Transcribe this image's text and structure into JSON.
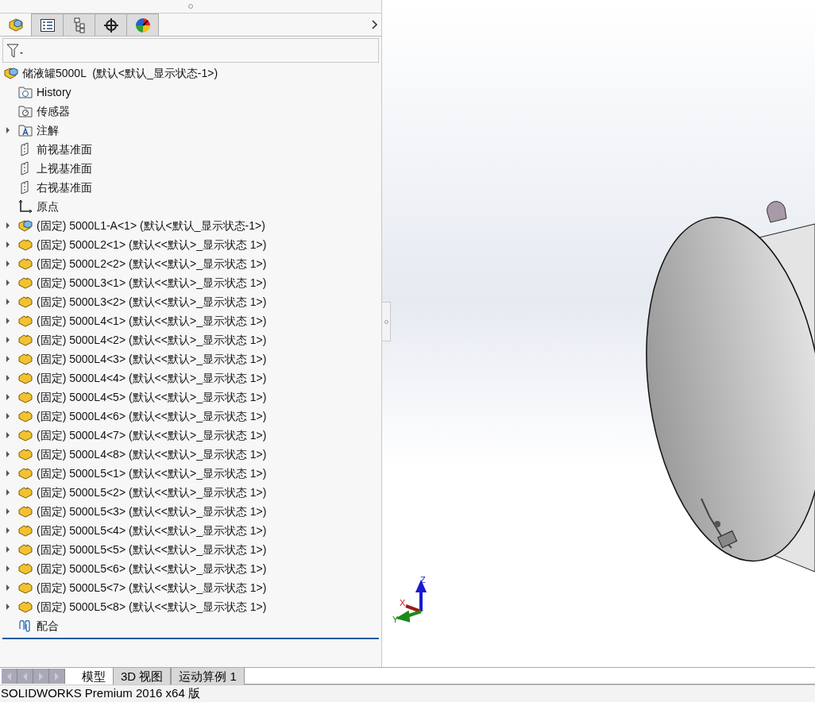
{
  "panel_tabs": [
    {
      "kind": "feature-tree",
      "selected": true
    },
    {
      "kind": "property",
      "selected": false
    },
    {
      "kind": "config",
      "selected": false
    },
    {
      "kind": "dimxpert",
      "selected": false
    },
    {
      "kind": "display",
      "selected": false
    }
  ],
  "tree": {
    "label": "储液罐5000L  (默认<默认_显示状态-1>)",
    "kind": "assembly",
    "children": [
      {
        "label": "History",
        "kind": "history"
      },
      {
        "label": "传感器",
        "kind": "sensor"
      },
      {
        "label": "注解",
        "kind": "annotation",
        "expanded": false
      },
      {
        "label": "前视基准面",
        "kind": "plane"
      },
      {
        "label": "上视基准面",
        "kind": "plane"
      },
      {
        "label": "右视基准面",
        "kind": "plane"
      },
      {
        "label": "原点",
        "kind": "origin"
      },
      {
        "label": "(固定) 5000L1-A<1> (默认<默认_显示状态-1>)",
        "kind": "assembly",
        "expanded": false
      },
      {
        "label": "(固定) 5000L2<1> (默认<<默认>_显示状态 1>)",
        "kind": "part",
        "expanded": false
      },
      {
        "label": "(固定) 5000L2<2> (默认<<默认>_显示状态 1>)",
        "kind": "part",
        "expanded": false
      },
      {
        "label": "(固定) 5000L3<1> (默认<<默认>_显示状态 1>)",
        "kind": "part",
        "expanded": false
      },
      {
        "label": "(固定) 5000L3<2> (默认<<默认>_显示状态 1>)",
        "kind": "part",
        "expanded": false
      },
      {
        "label": "(固定) 5000L4<1> (默认<<默认>_显示状态 1>)",
        "kind": "part",
        "expanded": false
      },
      {
        "label": "(固定) 5000L4<2> (默认<<默认>_显示状态 1>)",
        "kind": "part",
        "expanded": false
      },
      {
        "label": "(固定) 5000L4<3> (默认<<默认>_显示状态 1>)",
        "kind": "part",
        "expanded": false
      },
      {
        "label": "(固定) 5000L4<4> (默认<<默认>_显示状态 1>)",
        "kind": "part",
        "expanded": false
      },
      {
        "label": "(固定) 5000L4<5> (默认<<默认>_显示状态 1>)",
        "kind": "part",
        "expanded": false
      },
      {
        "label": "(固定) 5000L4<6> (默认<<默认>_显示状态 1>)",
        "kind": "part",
        "expanded": false
      },
      {
        "label": "(固定) 5000L4<7> (默认<<默认>_显示状态 1>)",
        "kind": "part",
        "expanded": false
      },
      {
        "label": "(固定) 5000L4<8> (默认<<默认>_显示状态 1>)",
        "kind": "part",
        "expanded": false
      },
      {
        "label": "(固定) 5000L5<1> (默认<<默认>_显示状态 1>)",
        "kind": "part",
        "expanded": false
      },
      {
        "label": "(固定) 5000L5<2> (默认<<默认>_显示状态 1>)",
        "kind": "part",
        "expanded": false
      },
      {
        "label": "(固定) 5000L5<3> (默认<<默认>_显示状态 1>)",
        "kind": "part",
        "expanded": false
      },
      {
        "label": "(固定) 5000L5<4> (默认<<默认>_显示状态 1>)",
        "kind": "part",
        "expanded": false
      },
      {
        "label": "(固定) 5000L5<5> (默认<<默认>_显示状态 1>)",
        "kind": "part",
        "expanded": false
      },
      {
        "label": "(固定) 5000L5<6> (默认<<默认>_显示状态 1>)",
        "kind": "part",
        "expanded": false
      },
      {
        "label": "(固定) 5000L5<7> (默认<<默认>_显示状态 1>)",
        "kind": "part",
        "expanded": false
      },
      {
        "label": "(固定) 5000L5<8> (默认<<默认>_显示状态 1>)",
        "kind": "part",
        "expanded": false
      },
      {
        "label": "配合",
        "kind": "mates"
      }
    ]
  },
  "triad": {
    "z": "Z",
    "x": "X",
    "y": "Y"
  },
  "bottom_tabs": [
    {
      "label": "模型",
      "selected": true
    },
    {
      "label": "3D 视图",
      "selected": false
    },
    {
      "label": "运动算例 1",
      "selected": false
    }
  ],
  "status_bar": "SOLIDWORKS Premium 2016 x64 版"
}
